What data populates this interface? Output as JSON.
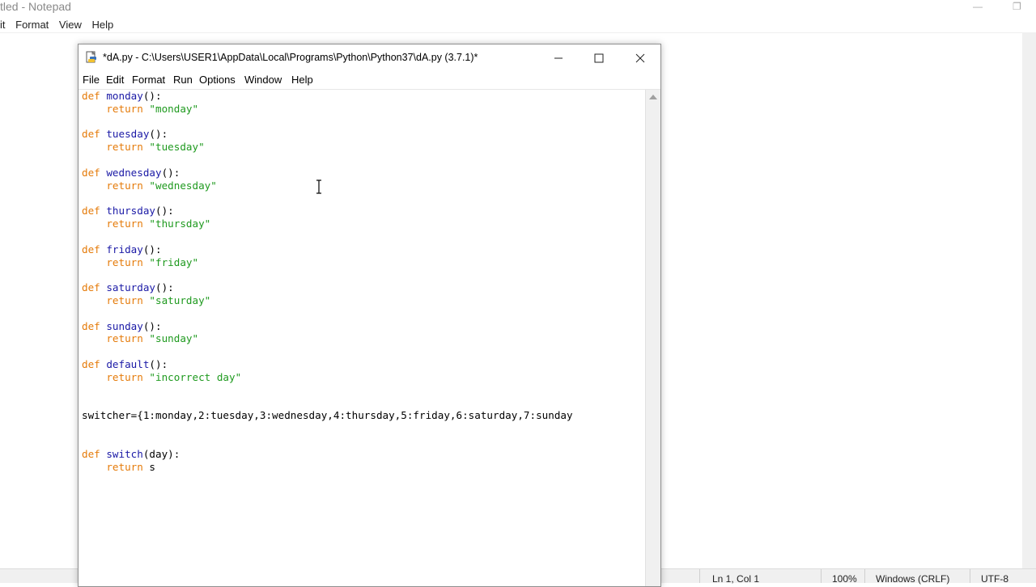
{
  "notepad": {
    "title": "tled - Notepad",
    "menu": [
      "it",
      "Format",
      "View",
      "Help"
    ],
    "status": {
      "position": "Ln 1, Col 1",
      "zoom": "100%",
      "line_ending": "Windows (CRLF)",
      "encoding": "UTF-8"
    }
  },
  "idle": {
    "title": "*dA.py - C:\\Users\\USER1\\AppData\\Local\\Programs\\Python\\Python37\\dA.py (3.7.1)*",
    "menu": [
      "File",
      "Edit",
      "Format",
      "Run",
      "Options",
      "Window",
      "Help"
    ],
    "code_lines": [
      [
        [
          "kw",
          "def "
        ],
        [
          "fn",
          "monday"
        ],
        [
          "",
          "():"
        ]
      ],
      [
        [
          "",
          "    "
        ],
        [
          "kw",
          "return "
        ],
        [
          "st",
          "\"monday\""
        ]
      ],
      [],
      [
        [
          "kw",
          "def "
        ],
        [
          "fn",
          "tuesday"
        ],
        [
          "",
          "():"
        ]
      ],
      [
        [
          "",
          "    "
        ],
        [
          "kw",
          "return "
        ],
        [
          "st",
          "\"tuesday\""
        ]
      ],
      [],
      [
        [
          "kw",
          "def "
        ],
        [
          "fn",
          "wednesday"
        ],
        [
          "",
          "():"
        ]
      ],
      [
        [
          "",
          "    "
        ],
        [
          "kw",
          "return "
        ],
        [
          "st",
          "\"wednesday\""
        ]
      ],
      [],
      [
        [
          "kw",
          "def "
        ],
        [
          "fn",
          "thursday"
        ],
        [
          "",
          "():"
        ]
      ],
      [
        [
          "",
          "    "
        ],
        [
          "kw",
          "return "
        ],
        [
          "st",
          "\"thursday\""
        ]
      ],
      [],
      [
        [
          "kw",
          "def "
        ],
        [
          "fn",
          "friday"
        ],
        [
          "",
          "():"
        ]
      ],
      [
        [
          "",
          "    "
        ],
        [
          "kw",
          "return "
        ],
        [
          "st",
          "\"friday\""
        ]
      ],
      [],
      [
        [
          "kw",
          "def "
        ],
        [
          "fn",
          "saturday"
        ],
        [
          "",
          "():"
        ]
      ],
      [
        [
          "",
          "    "
        ],
        [
          "kw",
          "return "
        ],
        [
          "st",
          "\"saturday\""
        ]
      ],
      [],
      [
        [
          "kw",
          "def "
        ],
        [
          "fn",
          "sunday"
        ],
        [
          "",
          "():"
        ]
      ],
      [
        [
          "",
          "    "
        ],
        [
          "kw",
          "return "
        ],
        [
          "st",
          "\"sunday\""
        ]
      ],
      [],
      [
        [
          "kw",
          "def "
        ],
        [
          "fn",
          "default"
        ],
        [
          "",
          "():"
        ]
      ],
      [
        [
          "",
          "    "
        ],
        [
          "kw",
          "return "
        ],
        [
          "st",
          "\"incorrect day\""
        ]
      ],
      [],
      [],
      [
        [
          "",
          "switcher={1:monday,2:tuesday,3:wednesday,4:thursday,5:friday,6:saturday,7:sunday"
        ]
      ],
      [],
      [],
      [
        [
          "kw",
          "def "
        ],
        [
          "fn",
          "switch"
        ],
        [
          "",
          "(day):"
        ]
      ],
      [
        [
          "",
          "    "
        ],
        [
          "kw",
          "return "
        ],
        [
          "",
          "s"
        ]
      ]
    ]
  },
  "colors": {
    "keyword": "#e57b0a",
    "definition": "#1a19a6",
    "string": "#1f9a1f"
  }
}
